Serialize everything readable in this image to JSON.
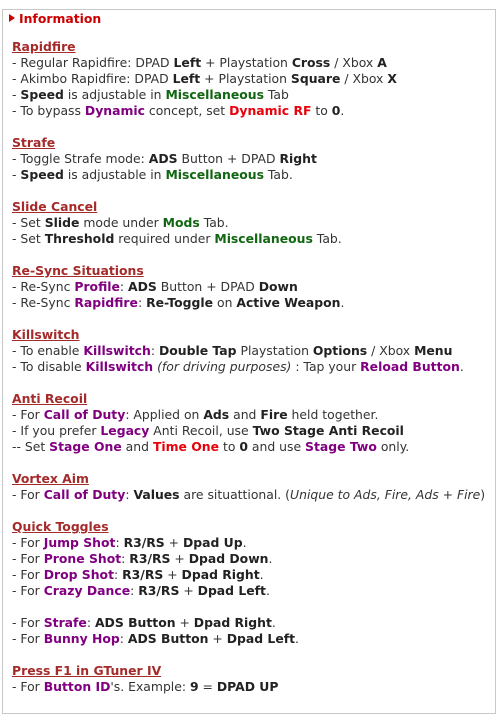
{
  "legend": "Information",
  "sections": [
    {
      "title": "Rapidfire",
      "lines": [
        [
          [
            "t",
            "- Regular Rapidfire: DPAD "
          ],
          [
            "b",
            "Left"
          ],
          [
            "t",
            " + Playstation "
          ],
          [
            "b",
            "Cross"
          ],
          [
            "t",
            " / Xbox "
          ],
          [
            "b",
            "A"
          ]
        ],
        [
          [
            "t",
            "- Akimbo Rapidfire: DPAD "
          ],
          [
            "b",
            "Left"
          ],
          [
            "t",
            " + Playstation "
          ],
          [
            "b",
            "Square"
          ],
          [
            "t",
            " / Xbox "
          ],
          [
            "b",
            "X"
          ]
        ],
        [
          [
            "t",
            "- "
          ],
          [
            "b",
            "Speed"
          ],
          [
            "t",
            " is adjustable in "
          ],
          [
            "g",
            "Miscellaneous"
          ],
          [
            "t",
            " Tab"
          ]
        ],
        [
          [
            "t",
            "- To bypass "
          ],
          [
            "p",
            "Dynamic"
          ],
          [
            "t",
            " concept, set "
          ],
          [
            "r",
            "Dynamic RF"
          ],
          [
            "t",
            " to "
          ],
          [
            "b",
            "0"
          ],
          [
            "t",
            "."
          ]
        ]
      ]
    },
    {
      "title": "Strafe",
      "lines": [
        [
          [
            "t",
            "- Toggle Strafe mode: "
          ],
          [
            "b",
            "ADS"
          ],
          [
            "t",
            " Button + DPAD "
          ],
          [
            "b",
            "Right"
          ]
        ],
        [
          [
            "t",
            "- "
          ],
          [
            "b",
            "Speed"
          ],
          [
            "t",
            " is adjustable in "
          ],
          [
            "g",
            "Miscellaneous"
          ],
          [
            "t",
            " Tab."
          ]
        ]
      ]
    },
    {
      "title": "Slide Cancel",
      "lines": [
        [
          [
            "t",
            "- Set "
          ],
          [
            "b",
            "Slide"
          ],
          [
            "t",
            " mode under "
          ],
          [
            "g",
            "Mods"
          ],
          [
            "t",
            " Tab."
          ]
        ],
        [
          [
            "t",
            "- Set "
          ],
          [
            "b",
            "Threshold"
          ],
          [
            "t",
            " required under "
          ],
          [
            "g",
            "Miscellaneous"
          ],
          [
            "t",
            " Tab."
          ]
        ]
      ]
    },
    {
      "title": "Re-Sync Situations",
      "lines": [
        [
          [
            "t",
            "- Re-Sync "
          ],
          [
            "p",
            "Profile"
          ],
          [
            "t",
            ": "
          ],
          [
            "b",
            "ADS"
          ],
          [
            "t",
            " Button + DPAD "
          ],
          [
            "b",
            "Down"
          ]
        ],
        [
          [
            "t",
            "- Re-Sync "
          ],
          [
            "p",
            "Rapidfire"
          ],
          [
            "t",
            ": "
          ],
          [
            "b",
            "Re-Toggle"
          ],
          [
            "t",
            " on "
          ],
          [
            "b",
            "Active Weapon"
          ],
          [
            "t",
            "."
          ]
        ]
      ]
    },
    {
      "title": "Killswitch",
      "lines": [
        [
          [
            "t",
            "- To enable "
          ],
          [
            "p",
            "Killswitch"
          ],
          [
            "t",
            ": "
          ],
          [
            "b",
            "Double Tap"
          ],
          [
            "t",
            " Playstation "
          ],
          [
            "b",
            "Options"
          ],
          [
            "t",
            " / Xbox "
          ],
          [
            "b",
            "Menu"
          ]
        ],
        [
          [
            "t",
            "- To disable "
          ],
          [
            "p",
            "Killswitch"
          ],
          [
            "t",
            " "
          ],
          [
            "i",
            "(for driving purposes)"
          ],
          [
            "t",
            " : Tap your "
          ],
          [
            "p",
            "Reload Button"
          ],
          [
            "t",
            "."
          ]
        ]
      ]
    },
    {
      "title": "Anti Recoil",
      "lines": [
        [
          [
            "t",
            "- For "
          ],
          [
            "p",
            "Call of Duty"
          ],
          [
            "t",
            ": Applied on "
          ],
          [
            "b",
            "Ads"
          ],
          [
            "t",
            " and "
          ],
          [
            "b",
            "Fire"
          ],
          [
            "t",
            " held together."
          ]
        ],
        [
          [
            "t",
            "- If you prefer "
          ],
          [
            "p",
            "Legacy"
          ],
          [
            "t",
            " Anti Recoil, use "
          ],
          [
            "b",
            "Two Stage Anti Recoil"
          ]
        ],
        [
          [
            "t",
            "-- Set "
          ],
          [
            "p",
            "Stage One"
          ],
          [
            "t",
            " and "
          ],
          [
            "r",
            "Time One"
          ],
          [
            "t",
            " to "
          ],
          [
            "b",
            "0"
          ],
          [
            "t",
            " and use "
          ],
          [
            "p",
            "Stage Two"
          ],
          [
            "t",
            " only."
          ]
        ]
      ]
    },
    {
      "title": "Vortex Aim",
      "lines": [
        [
          [
            "t",
            "- For "
          ],
          [
            "p",
            "Call of Duty"
          ],
          [
            "t",
            ": "
          ],
          [
            "b",
            "Values"
          ],
          [
            "t",
            " are situattional. ("
          ],
          [
            "i",
            "Unique to Ads, Fire, Ads + Fire"
          ],
          [
            "t",
            ")"
          ]
        ]
      ]
    },
    {
      "title": "Quick Toggles",
      "lines": [
        [
          [
            "t",
            "- For "
          ],
          [
            "p",
            "Jump Shot"
          ],
          [
            "t",
            ": "
          ],
          [
            "b",
            "R3/RS"
          ],
          [
            "t",
            " + "
          ],
          [
            "b",
            "Dpad Up"
          ],
          [
            "t",
            "."
          ]
        ],
        [
          [
            "t",
            "- For "
          ],
          [
            "p",
            "Prone Shot"
          ],
          [
            "t",
            ": "
          ],
          [
            "b",
            "R3/RS"
          ],
          [
            "t",
            " + "
          ],
          [
            "b",
            "Dpad Down"
          ],
          [
            "t",
            "."
          ]
        ],
        [
          [
            "t",
            "- For "
          ],
          [
            "p",
            "Drop Shot"
          ],
          [
            "t",
            ": "
          ],
          [
            "b",
            "R3/RS"
          ],
          [
            "t",
            " + "
          ],
          [
            "b",
            "Dpad Right"
          ],
          [
            "t",
            "."
          ]
        ],
        [
          [
            "t",
            "- For "
          ],
          [
            "p",
            "Crazy Dance"
          ],
          [
            "t",
            ": "
          ],
          [
            "b",
            "R3/RS"
          ],
          [
            "t",
            " + "
          ],
          [
            "b",
            "Dpad Left"
          ],
          [
            "t",
            "."
          ]
        ],
        [],
        [
          [
            "t",
            "- For "
          ],
          [
            "p",
            "Strafe"
          ],
          [
            "t",
            ": "
          ],
          [
            "b",
            "ADS Button"
          ],
          [
            "t",
            " + "
          ],
          [
            "b",
            "Dpad Right"
          ],
          [
            "t",
            "."
          ]
        ],
        [
          [
            "t",
            "- For "
          ],
          [
            "p",
            "Bunny Hop"
          ],
          [
            "t",
            ": "
          ],
          [
            "b",
            "ADS Button"
          ],
          [
            "t",
            " + "
          ],
          [
            "b",
            "Dpad Left"
          ],
          [
            "t",
            "."
          ]
        ]
      ]
    },
    {
      "title": "Press F1 in GTuner IV",
      "lines": [
        [
          [
            "t",
            "- For "
          ],
          [
            "p",
            "Button ID"
          ],
          [
            "t",
            "'s. Example: "
          ],
          [
            "b",
            "9"
          ],
          [
            "t",
            " = "
          ],
          [
            "b",
            "DPAD UP"
          ]
        ]
      ]
    }
  ]
}
